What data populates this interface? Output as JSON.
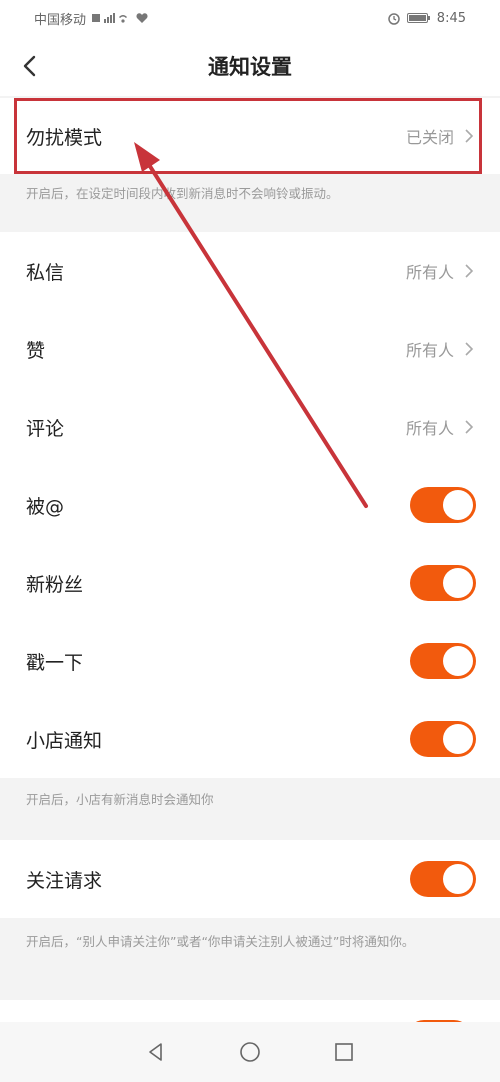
{
  "status_bar": {
    "carrier": "中国移动",
    "time": "8:45"
  },
  "nav": {
    "title": "通知设置"
  },
  "dnd": {
    "label": "勿扰模式",
    "value": "已关闭",
    "hint": "开启后，在设定时间段内收到新消息时不会响铃或振动。"
  },
  "rows": {
    "private_message": {
      "label": "私信",
      "value": "所有人"
    },
    "likes": {
      "label": "赞",
      "value": "所有人"
    },
    "comments": {
      "label": "评论",
      "value": "所有人"
    },
    "mentioned": {
      "label": "被@"
    },
    "new_fans": {
      "label": "新粉丝"
    },
    "poke": {
      "label": "戳一下"
    },
    "shop": {
      "label": "小店通知"
    },
    "follow_request": {
      "label": "关注请求"
    }
  },
  "hints": {
    "shop": "开启后，小店有新消息时会通知你",
    "follow_request": "开启后，“别人申请关注你”或者“你申请关注别人被通过”时将通知你。"
  },
  "toggles": {
    "mentioned": true,
    "new_fans": true,
    "poke": true,
    "shop": true,
    "follow_request": true
  },
  "colors": {
    "accent": "#f25a0d",
    "annotation": "#c8343a",
    "background": "#f3f3f3"
  },
  "icons": {
    "back": "chevron-left-icon",
    "row_arrow": "chevron-right-icon",
    "nav_back": "triangle-back-icon",
    "nav_home": "circle-home-icon",
    "nav_recent": "square-recent-icon"
  }
}
